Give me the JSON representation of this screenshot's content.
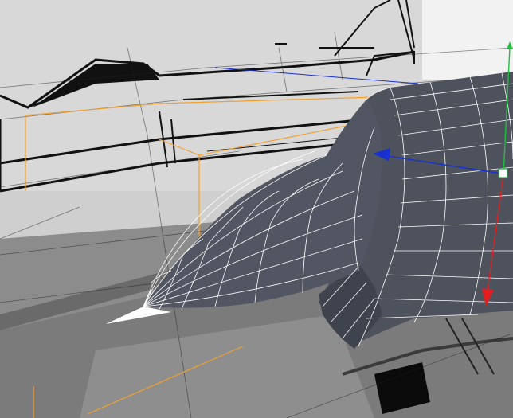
{
  "viewport": {
    "description_free": true,
    "background_color": "#8a8a8a",
    "backdrop_color": "#d4d4d4",
    "mesh_color": "#4a4e58",
    "wire_color": "#ffffff",
    "selection_color": "#f0a030",
    "axis_x_color": "#e02020",
    "axis_y_color": "#20c040",
    "axis_z_color": "#1830d0",
    "icons": {
      "move_gizmo": "move-gizmo-icon",
      "axis_x_handle": "arrow-down-icon",
      "axis_z_handle": "arrow-left-icon",
      "axis_y_handle": "arrow-up-icon",
      "scale_handle": "cube-handle-icon"
    }
  }
}
